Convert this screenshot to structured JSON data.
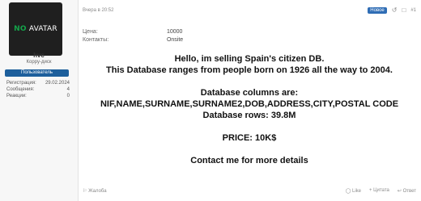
{
  "user": {
    "avatar_text_left": "NO",
    "avatar_text_right": "AVATAR",
    "name": "hvc",
    "title": "Корру-диск",
    "role_badge": "Пользователь",
    "stats": [
      {
        "label": "Регистрация:",
        "value": "29.02.2024"
      },
      {
        "label": "Сообщения:",
        "value": "4"
      },
      {
        "label": "Реакции:",
        "value": "0"
      }
    ]
  },
  "post": {
    "date": "Вчера в 20:52",
    "new_badge": "Новое",
    "post_number": "#1",
    "fields": [
      {
        "label": "Цена:",
        "value": "10000"
      },
      {
        "label": "Контакты:",
        "value": "Onsite"
      }
    ],
    "lines": {
      "l1": "Hello, im selling Spain's citizen DB.",
      "l2": "This Database ranges from people born on 1926 all the way to 2004.",
      "l3": "Database columns are:",
      "l4": "NIF,NAME,SURNAME,SURNAME2,DOB,ADDRESS,CITY,POSTAL CODE",
      "l5": "Database rows: 39.8M",
      "l6": "PRICE: 10K$",
      "l7": "Contact me for more details"
    },
    "footer": {
      "report": "Жалоба",
      "like": "Like",
      "quote": "+ Цитата",
      "reply": "Ответ"
    }
  },
  "icons": {
    "share": "share-icon",
    "bookmark": "bookmark-icon",
    "report": "flag-icon",
    "like": "thumbs-up-icon",
    "reply": "reply-icon"
  },
  "colors": {
    "role_badge": "#1d5f9c",
    "new_badge": "#2f6db5"
  }
}
